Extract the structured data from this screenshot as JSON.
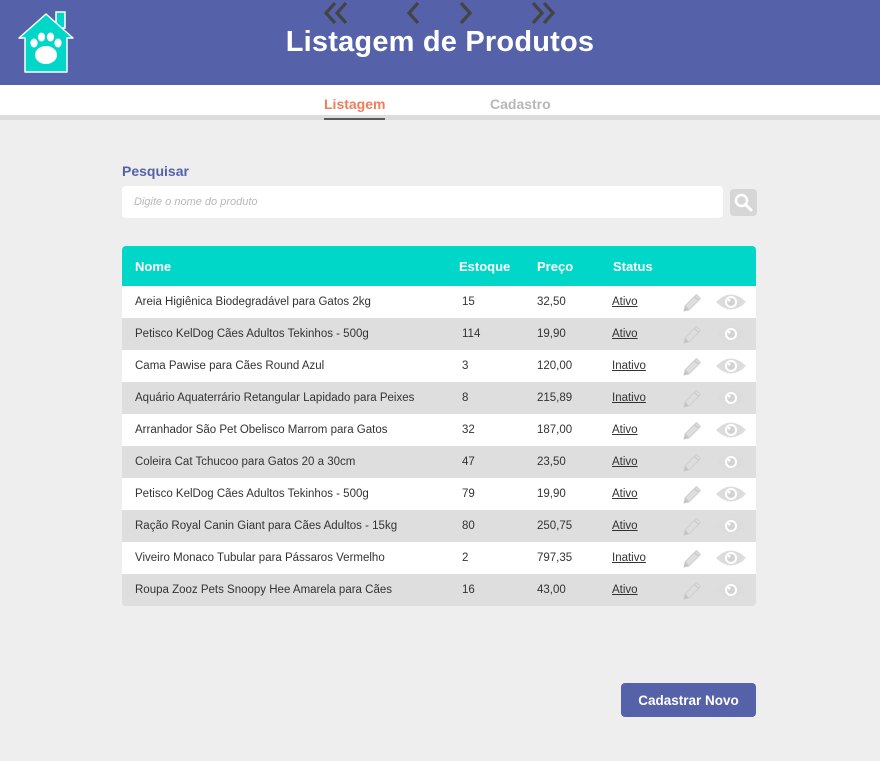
{
  "header": {
    "title": "Listagem de Produtos",
    "logo_icon": "house-paw-icon",
    "background": "#5561a9"
  },
  "tabs": [
    {
      "label": "Listagem",
      "active": true
    },
    {
      "label": "Cadastro",
      "active": false
    }
  ],
  "search": {
    "label": "Pesquisar",
    "placeholder": "Digite o nome do produto",
    "value": "",
    "button_icon": "search-icon"
  },
  "table": {
    "columns": [
      "Nome",
      "Estoque",
      "Preço",
      "Status"
    ],
    "header_color": "#00d7c8",
    "row_actions": [
      "edit-pencil-icon",
      "view-eye-icon"
    ],
    "rows": [
      {
        "nome": "Areia Higiênica Biodegradável para Gatos 2kg",
        "estoque": "15",
        "preco": "32,50",
        "status": "Ativo"
      },
      {
        "nome": "Petisco KelDog Cães Adultos Tekinhos - 500g",
        "estoque": "114",
        "preco": "19,90",
        "status": "Ativo"
      },
      {
        "nome": "Cama Pawise para Cães Round Azul",
        "estoque": "3",
        "preco": "120,00",
        "status": "Inativo"
      },
      {
        "nome": "Aquário Aquaterrário Retangular Lapidado para Peixes",
        "estoque": "8",
        "preco": "215,89",
        "status": "Inativo"
      },
      {
        "nome": "Arranhador São Pet Obelisco Marrom para Gatos",
        "estoque": "32",
        "preco": "187,00",
        "status": "Ativo"
      },
      {
        "nome": "Coleira Cat Tchucoo para Gatos 20 a 30cm",
        "estoque": "47",
        "preco": "23,50",
        "status": "Ativo"
      },
      {
        "nome": "Petisco KelDog Cães Adultos Tekinhos - 500g",
        "estoque": "79",
        "preco": "19,90",
        "status": "Ativo"
      },
      {
        "nome": "Ração Royal Canin Giant para Cães Adultos - 15kg",
        "estoque": "80",
        "preco": "250,75",
        "status": "Ativo"
      },
      {
        "nome": "Viveiro Monaco Tubular para Pássaros Vermelho",
        "estoque": "2",
        "preco": "797,35",
        "status": "Inativo"
      },
      {
        "nome": "Roupa Zooz Pets Snoopy Hee Amarela para Cães",
        "estoque": "16",
        "preco": "43,00",
        "status": "Ativo"
      }
    ]
  },
  "pagination": {
    "first_icon": "double-chevron-left-icon",
    "prev_icon": "chevron-left-icon",
    "next_icon": "chevron-right-icon",
    "last_icon": "double-chevron-right-icon"
  },
  "actions": {
    "new_label": "Cadastrar Novo",
    "accent": "#5561a9"
  }
}
